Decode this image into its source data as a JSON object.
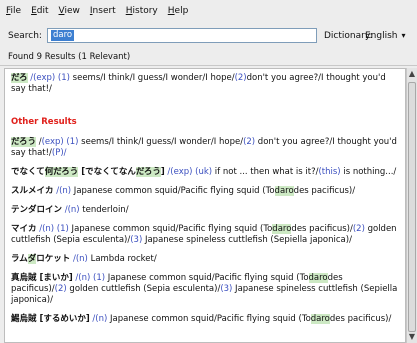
{
  "menu": {
    "file": "File",
    "edit": "Edit",
    "view": "View",
    "insert": "Insert",
    "history": "History",
    "help": "Help"
  },
  "search": {
    "label": "Search:",
    "value": "daro"
  },
  "dictionary": {
    "label": "Dictionary:",
    "selected": "English"
  },
  "status": {
    "found": "Found 9 Results (1 Relevant)"
  },
  "colors": {
    "other_header": "#e0201b",
    "link": "#3b4fbf",
    "highlight": "#cde9c4",
    "selection": "#3d7fd1"
  },
  "results": {
    "relevant": {
      "term": "だろ",
      "tag": "/(exp)",
      "n1": "(1)",
      "text1": "seems/I think/I guess/I wonder/I hope/",
      "n2": "(2)",
      "text2": "don't you agree?/I thought you'd say that!/"
    },
    "other_header": "Other Results",
    "items": [
      {
        "term": "だろう",
        "part1": " /",
        "tag": "(exp)",
        "n1": " (1) ",
        "text1": "seems/I think/I guess/I wonder/I hope/",
        "n2": "(2)",
        "text2": " don't you agree?/I thought you'd say that!/",
        "tail": "(P)/"
      },
      {
        "term_pre": "でなくて",
        "term_hl": "何だろう",
        "term_post": " [でなくてなん",
        "term_hl2": "だろう",
        "term_end": "]",
        "tag": " /(exp)",
        "tag2": " (uk)",
        "text1": " if not ... then what is it?/",
        "n1": "(this)",
        "text2": " is nothing.../"
      },
      {
        "term_pre": "スルメイカ",
        "tag": " /(n)",
        "text1": " Japanese common squid/Pacific flying squid (To",
        "hl": "daro",
        "text2": "des pacificus)/"
      },
      {
        "term_pre": "テンダロイン",
        "tag": " /(n)",
        "text1": " tenderloin/"
      },
      {
        "term_pre": "マイカ",
        "tag": " /(n)",
        "n1": " (1)",
        "text1": " Japanese common squid/Pacific flying squid (To",
        "hl": "daro",
        "text2": "des pacificus)/",
        "n2": "(2)",
        "text3": " golden cuttlefish (Sepia esculenta)/",
        "n3": "(3)",
        "text4": " Japanese spineless cuttlefish (Sepiella japonica)/"
      },
      {
        "term_pre": "ラム",
        "term_hl": "ダ",
        "term_post": "ロケット",
        "tag": " /(n)",
        "text1": " Lambda rocket/"
      },
      {
        "term_pre": "真烏賊 [まいか]",
        "tag": " /(n)",
        "n1": " (1)",
        "text1": " Japanese common squid/Pacific flying squid (To",
        "hl": "daro",
        "text2": "des pacificus)/",
        "n2": "(2)",
        "text3": " golden cuttlefish (Sepia esculenta)/",
        "n3": "(3)",
        "text4": " Japanese spineless cuttlefish (Sepiella japonica)/"
      },
      {
        "term_pre": "鯣烏賊 [するめいか]",
        "tag": " /(n)",
        "text1": " Japanese common squid/Pacific flying squid (To",
        "hl": "daro",
        "text2": "des pacificus)/"
      }
    ]
  }
}
